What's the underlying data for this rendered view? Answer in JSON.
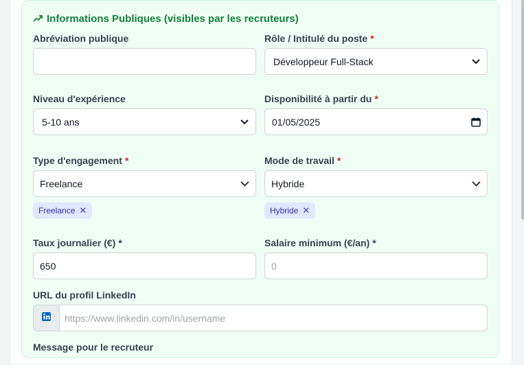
{
  "section": {
    "title": "Informations Publiques (visibles par les recruteurs)"
  },
  "fields": {
    "abbreviation": {
      "label": "Abréviation publique",
      "value": ""
    },
    "role": {
      "label": "Rôle / Intitulé du poste",
      "required": "*",
      "value": "Développeur Full-Stack"
    },
    "experience": {
      "label": "Niveau d'expérience",
      "value": "5-10 ans"
    },
    "availability": {
      "label": "Disponibilité à partir du",
      "required": "*",
      "value": "01/05/2025"
    },
    "engagement": {
      "label": "Type d'engagement",
      "required": "*",
      "value": "Freelance",
      "chips": [
        "Freelance"
      ]
    },
    "work_mode": {
      "label": "Mode de travail",
      "required": "*",
      "value": "Hybride",
      "chips": [
        "Hybride"
      ]
    },
    "daily_rate": {
      "label": "Taux journalier (€)",
      "required": "*",
      "value": "650"
    },
    "min_salary": {
      "label": "Salaire minimum (€/an)",
      "required": "*",
      "placeholder": "0"
    },
    "linkedin": {
      "label": "URL du profil LinkedIn",
      "placeholder": "https://www.linkedin.com/in/username"
    },
    "message": {
      "label": "Message pour le recruteur"
    }
  },
  "icons": {
    "section": "trending-up-icon",
    "select": "chevron-down-icon",
    "date": "calendar-icon",
    "chip_remove": "close-icon",
    "linkedin": "linkedin-icon"
  },
  "colors": {
    "section_title": "#15803d",
    "panel_bg": "#f0fdf4",
    "required": "#dc2626",
    "chip_bg": "#e0e7ff",
    "chip_text": "#3730a3",
    "linkedin": "#0a66c2"
  }
}
